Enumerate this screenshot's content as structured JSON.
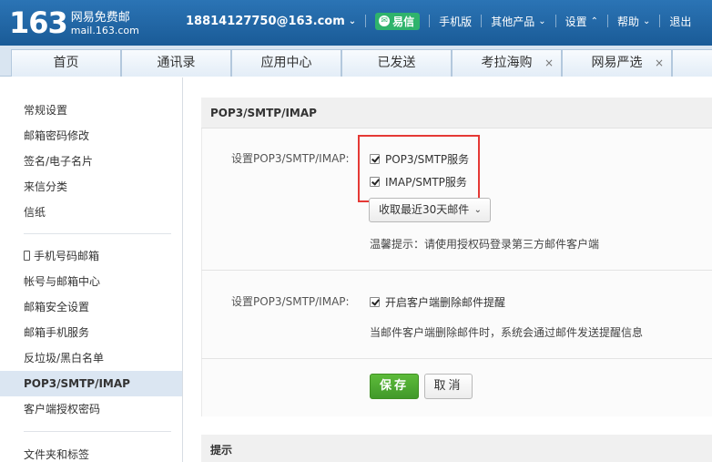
{
  "header": {
    "logo_number": "163",
    "logo_cn": "网易免费邮",
    "logo_url": "mail.163.com",
    "account": "18814127750@163.com",
    "yixin": "易信",
    "mobile": "手机版",
    "other_products": "其他产品",
    "settings": "设置",
    "help": "帮助",
    "logout": "退出"
  },
  "tabs": [
    {
      "label": "首页"
    },
    {
      "label": "通讯录"
    },
    {
      "label": "应用中心"
    },
    {
      "label": "已发送"
    },
    {
      "label": "考拉海购",
      "close": "×"
    },
    {
      "label": "网易严选",
      "close": "×"
    }
  ],
  "sidebar": {
    "group1": [
      "常规设置",
      "邮箱密码修改",
      "签名/电子名片",
      "来信分类",
      "信纸"
    ],
    "group2": [
      "手机号码邮箱",
      "帐号与邮箱中心",
      "邮箱安全设置",
      "邮箱手机服务",
      "反垃圾/黑白名单",
      "POP3/SMTP/IMAP",
      "客户端授权密码"
    ],
    "group3": [
      "文件夹和标签"
    ],
    "active": "POP3/SMTP/IMAP"
  },
  "main": {
    "section_title": "POP3/SMTP/IMAP",
    "row1_label": "设置POP3/SMTP/IMAP:",
    "pop3_smtp": "POP3/SMTP服务",
    "imap_smtp": "IMAP/SMTP服务",
    "pop3_checked": true,
    "imap_checked": true,
    "receive_select": "收取最近30天邮件",
    "warm_tip": "温馨提示：请使用授权码登录第三方邮件客户端",
    "row2_label": "设置POP3/SMTP/IMAP:",
    "delete_notify": "开启客户端删除邮件提醒",
    "delete_notify_checked": true,
    "delete_desc": "当邮件客户端删除邮件时，系统会通过邮件发送提醒信息",
    "save": "保存",
    "cancel": "取消",
    "tips_title": "提示"
  },
  "colors": {
    "header_blue": "#1c5f9c",
    "save_green": "#4ca630",
    "highlight_red": "#e53935",
    "yixin_green": "#2fb36c"
  }
}
